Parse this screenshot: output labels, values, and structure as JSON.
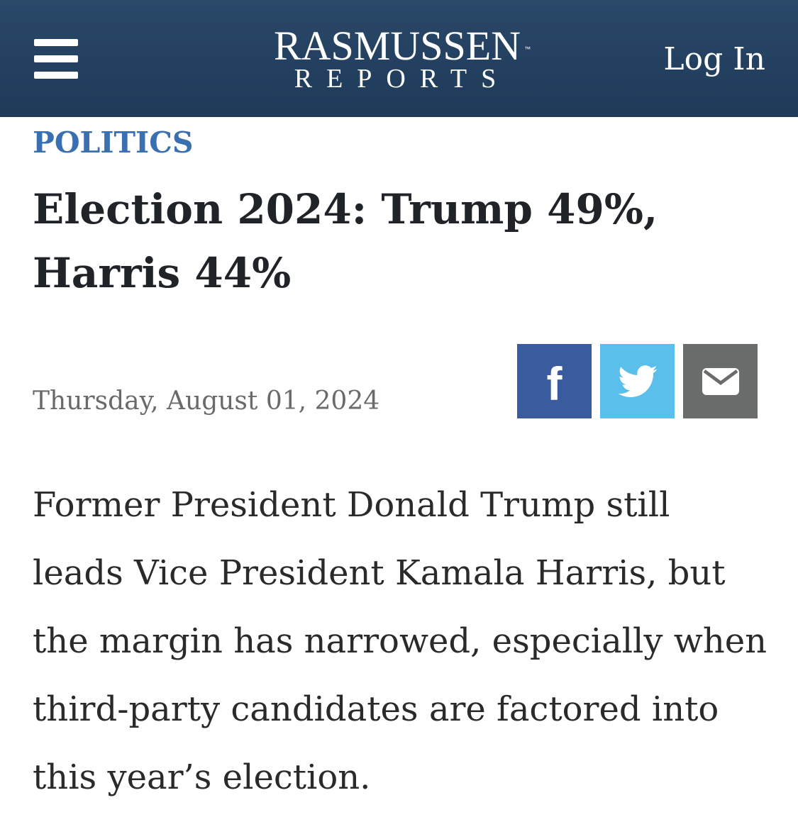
{
  "header": {
    "menu_icon": "hamburger-menu-icon",
    "logo": {
      "line1": "RASMUSSEN",
      "trademark": "™",
      "line2": "REPORTS"
    },
    "login_label": "Log In",
    "background": "#23405f"
  },
  "article": {
    "category": "POLITICS",
    "title": "Election 2024: Trump 49%, Harris 44%",
    "date": "Thursday, August 01, 2024",
    "share": [
      {
        "name": "facebook",
        "icon": "facebook-icon",
        "color": "#3b5b9f"
      },
      {
        "name": "twitter",
        "icon": "twitter-icon",
        "color": "#5bbfeb"
      },
      {
        "name": "email",
        "icon": "email-icon",
        "color": "#6a6c6c"
      }
    ],
    "body": "Former President Donald Trump still leads Vice President Kamala Harris, but the margin has narrowed, especially when third-party candidates are factored into this year’s election."
  },
  "colors": {
    "accent": "#3a6fb0",
    "headline": "#202327",
    "date": "#6a6a6a"
  }
}
